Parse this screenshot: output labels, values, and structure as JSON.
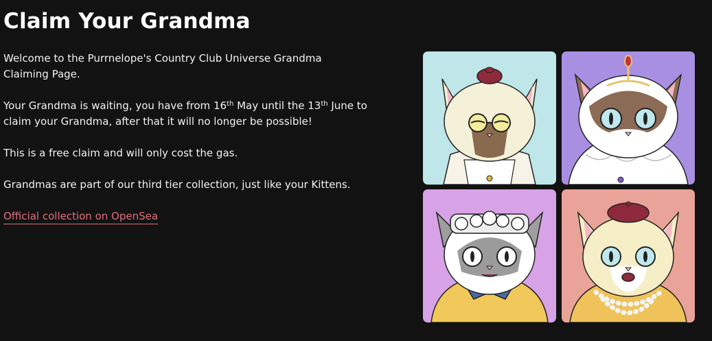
{
  "page": {
    "title": "Claim Your Grandma"
  },
  "intro": {
    "welcome": "Welcome to the Purrnelope's Country Club Universe Grandma Claiming Page.",
    "waiting_part1": "Your Grandma is waiting, you have from 16",
    "waiting_sup1": "th",
    "waiting_part2": " May until the 13",
    "waiting_sup2": "th",
    "waiting_part3": " June to claim your Grandma, after that it will no longer be possible!",
    "free_claim": "This is a free claim and will only cost the gas.",
    "tier": "Grandmas are part of our third tier collection, just like your Kittens.",
    "link_label": "Official collection on OpenSea"
  },
  "gallery": {
    "images": [
      {
        "name": "grandma-cat-cream-glasses-image",
        "bg": "#bfe6e8"
      },
      {
        "name": "grandma-cat-brown-tiara-image",
        "bg": "#a98fe2"
      },
      {
        "name": "grandma-cat-grey-curlers-image",
        "bg": "#d7a2e6"
      },
      {
        "name": "grandma-cat-cream-beret-pearls-image",
        "bg": "#e9a398"
      }
    ]
  },
  "colors": {
    "background": "#121212",
    "link": "#e26e7d"
  }
}
